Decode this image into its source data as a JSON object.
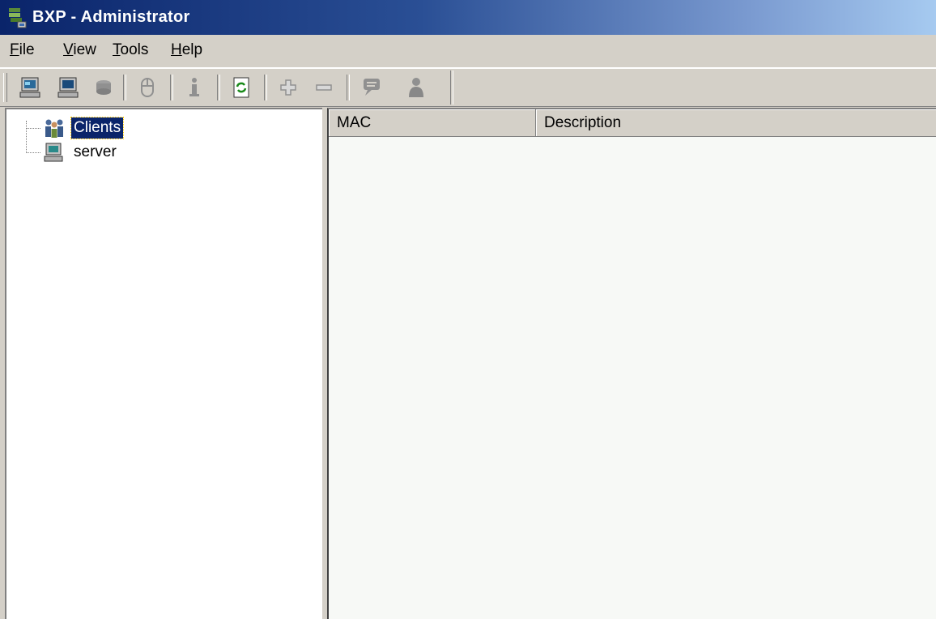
{
  "window": {
    "title": "BXP - Administrator"
  },
  "menu": [
    {
      "prefix": "",
      "u": "F",
      "rest": "ile"
    },
    {
      "prefix": "",
      "u": "V",
      "rest": "iew"
    },
    {
      "prefix": "",
      "u": "T",
      "rest": "ools"
    },
    {
      "prefix": "",
      "u": "H",
      "rest": "elp"
    }
  ],
  "toolbar": {
    "buttons": [
      "client-computer-icon",
      "computer-icon",
      "disk-icon",
      "mouse-icon",
      "info-icon",
      "refresh-icon",
      "add-icon",
      "remove-icon",
      "chat-icon",
      "user-icon"
    ]
  },
  "tree": {
    "items": [
      {
        "label": "Clients",
        "icon": "clients-group-icon",
        "selected": true
      },
      {
        "label": "server",
        "icon": "server-computer-icon",
        "selected": false
      }
    ]
  },
  "list": {
    "columns": [
      "MAC",
      "Description"
    ],
    "rows": []
  }
}
